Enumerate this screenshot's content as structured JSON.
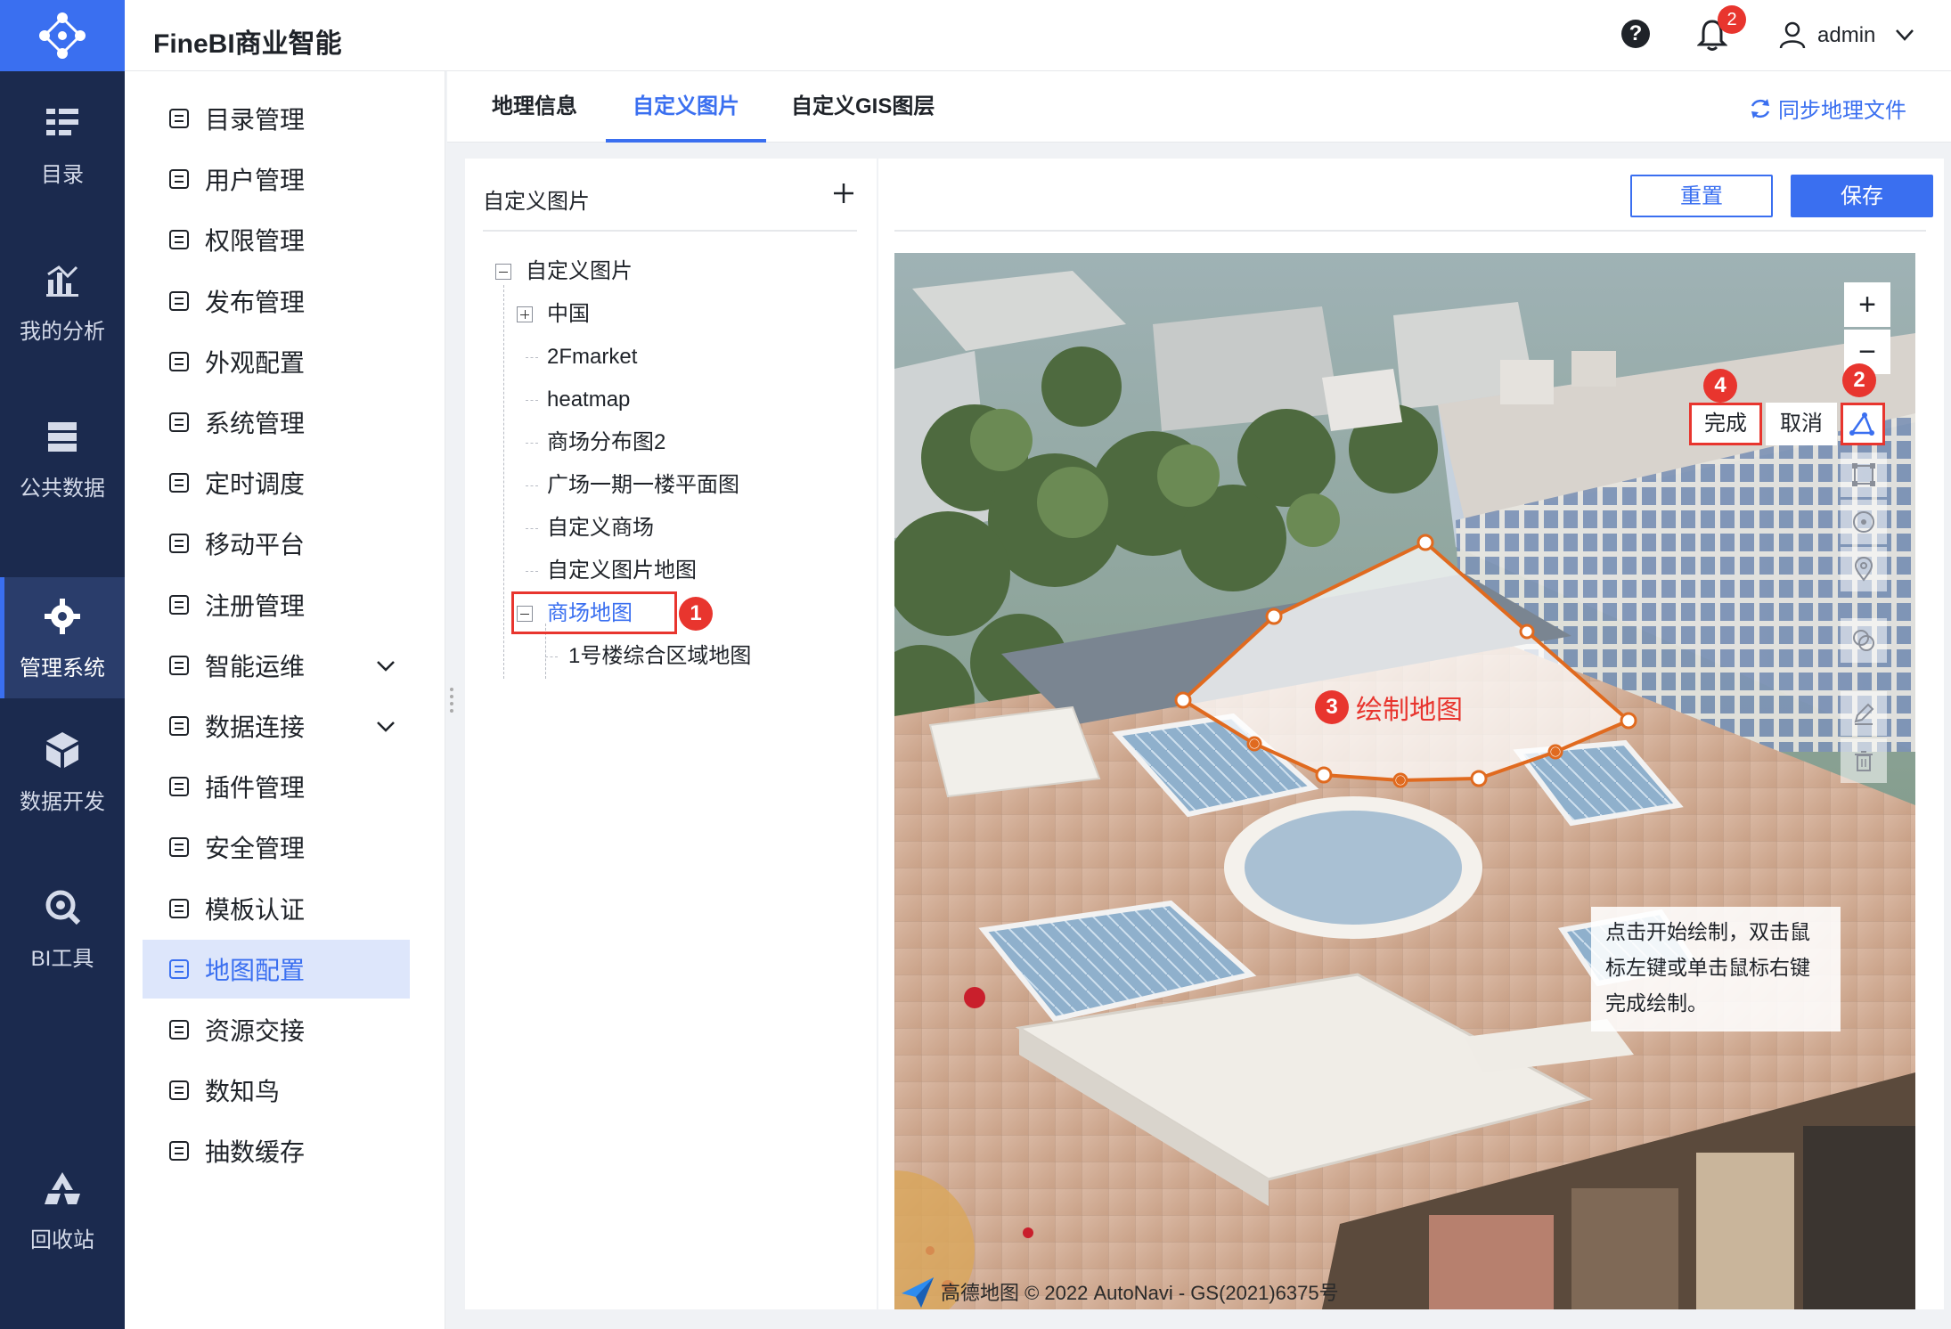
{
  "app": {
    "title": "FineBI商业智能"
  },
  "header": {
    "help_icon": "?",
    "notification_count": "2",
    "user_name": "admin"
  },
  "rail": {
    "items": [
      {
        "label": "目录",
        "icon": "catalog-icon"
      },
      {
        "label": "我的分析",
        "icon": "analysis-icon"
      },
      {
        "label": "公共数据",
        "icon": "database-icon"
      },
      {
        "label": "管理系统",
        "icon": "gear-icon",
        "active": true
      },
      {
        "label": "数据开发",
        "icon": "cube-icon"
      },
      {
        "label": "BI工具",
        "icon": "tool-icon"
      },
      {
        "label": "回收站",
        "icon": "recycle-icon"
      }
    ]
  },
  "sidebar": {
    "items": [
      {
        "label": "目录管理"
      },
      {
        "label": "用户管理"
      },
      {
        "label": "权限管理"
      },
      {
        "label": "发布管理"
      },
      {
        "label": "外观配置"
      },
      {
        "label": "系统管理"
      },
      {
        "label": "定时调度"
      },
      {
        "label": "移动平台"
      },
      {
        "label": "注册管理"
      },
      {
        "label": "智能运维",
        "expandable": true
      },
      {
        "label": "数据连接",
        "expandable": true
      },
      {
        "label": "插件管理"
      },
      {
        "label": "安全管理"
      },
      {
        "label": "模板认证"
      },
      {
        "label": "地图配置",
        "active": true
      },
      {
        "label": "资源交接"
      },
      {
        "label": "数知鸟"
      },
      {
        "label": "抽数缓存"
      }
    ]
  },
  "tabs": [
    {
      "label": "地理信息"
    },
    {
      "label": "自定义图片",
      "active": true
    },
    {
      "label": "自定义GIS图层"
    }
  ],
  "sync_label": "同步地理文件",
  "tree": {
    "panel_title": "自定义图片",
    "root": "自定义图片",
    "nodes": [
      "中国",
      "2Fmarket",
      "heatmap",
      "商场分布图2",
      "广场一期一楼平面图",
      "自定义商场",
      "自定义图片地图",
      "商场地图"
    ],
    "child": "1号楼综合区域地图"
  },
  "buttons": {
    "reset": "重置",
    "save": "保存"
  },
  "map": {
    "zoom_in": "+",
    "zoom_out": "−",
    "finish": "完成",
    "cancel": "取消",
    "draw_label": "绘制地图",
    "tip": "点击开始绘制，双击鼠标左键或单击鼠标右键完成绘制。",
    "attribution": "高德地图 © 2022 AutoNavi - GS(2021)6375号"
  },
  "steps": {
    "one": "1",
    "two": "2",
    "three": "3",
    "four": "4"
  },
  "colors": {
    "accent": "#3a6ff0",
    "rail": "#1b2a4e",
    "highlight": "#e8352e",
    "polygon_stroke": "#e06a1f"
  }
}
